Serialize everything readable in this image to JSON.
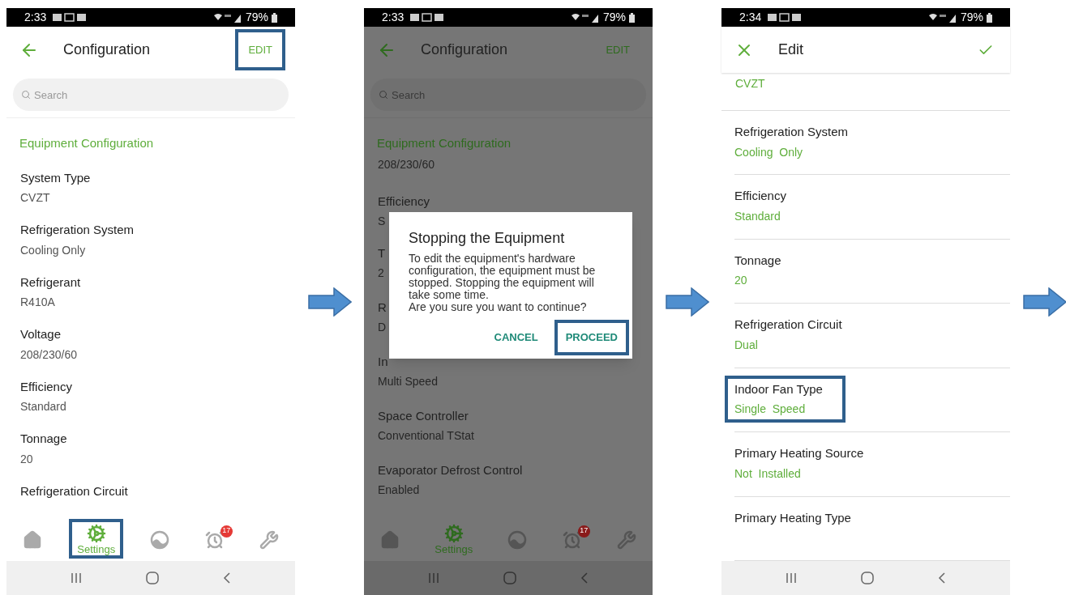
{
  "screens": [
    {
      "dimmed": false,
      "status": {
        "time": "2:33",
        "battery": "79%"
      },
      "header": {
        "kind": "back",
        "title": "Configuration",
        "action": {
          "kind": "text",
          "label": "EDIT",
          "highlighted": true
        }
      },
      "search": {
        "placeholder": "Search"
      },
      "section": "Equipment Configuration",
      "rows": [
        {
          "label": "System Type",
          "value": "CVZT",
          "highlighted": false
        },
        {
          "label": "Refrigeration System",
          "value": "Cooling Only",
          "highlighted": false
        },
        {
          "label": "Refrigerant",
          "value": "R410A",
          "highlighted": false
        },
        {
          "label": "Voltage",
          "value": "208/230/60",
          "highlighted": false
        },
        {
          "label": "Efficiency",
          "value": "Standard",
          "highlighted": false
        },
        {
          "label": "Tonnage",
          "value": "20",
          "highlighted": false
        },
        {
          "label": "Refrigeration Circuit",
          "highlighted": false
        }
      ],
      "tabs": [
        {
          "selected": false,
          "highlighted": false
        },
        {
          "label": "Settings",
          "selected": true,
          "highlighted": true
        },
        {
          "selected": false,
          "highlighted": false
        },
        {
          "badge": "17",
          "selected": false,
          "highlighted": false
        },
        {
          "selected": false,
          "highlighted": false
        }
      ]
    },
    {
      "dimmed": true,
      "status": {
        "time": "2:33",
        "battery": "79%"
      },
      "header": {
        "kind": "back",
        "title": "Configuration",
        "action": {
          "kind": "text",
          "label": "EDIT",
          "highlighted": false
        }
      },
      "search": {
        "placeholder": "Search"
      },
      "section": "Equipment Configuration",
      "lead_value": "208/230/60",
      "rows": [
        {
          "label": "Efficiency",
          "value": "S",
          "highlighted": false
        },
        {
          "label": "T",
          "value": "2",
          "highlighted": false
        },
        {
          "label": "R",
          "value": "D",
          "highlighted": false
        },
        {
          "label": "In",
          "value": "Multi Speed",
          "highlighted": false
        },
        {
          "label": "Space Controller",
          "value": "Conventional TStat",
          "highlighted": false
        },
        {
          "label": "Evaporator Defrost Control",
          "value": "Enabled",
          "highlighted": false
        }
      ],
      "dialog": {
        "title": "Stopping the Equipment",
        "message": "To edit the equipment's hardware configuration, the equipment must be stopped. Stopping the equipment will take some time.\nAre you sure you want to continue?",
        "buttons": [
          {
            "label": "CANCEL",
            "highlighted": false
          },
          {
            "label": "PROCEED",
            "highlighted": true
          }
        ]
      },
      "tabs": [
        {
          "selected": false,
          "highlighted": false
        },
        {
          "label": "Settings",
          "selected": true,
          "highlighted": false
        },
        {
          "selected": false,
          "highlighted": false
        },
        {
          "badge": "17",
          "selected": false,
          "highlighted": false
        },
        {
          "selected": false,
          "highlighted": false
        }
      ]
    },
    {
      "dimmed": false,
      "status": {
        "time": "2:34",
        "battery": "79%"
      },
      "header": {
        "kind": "close",
        "title": "Edit",
        "action": {
          "kind": "check",
          "highlighted": false
        }
      },
      "lead_value": "CVZT",
      "rows": [
        {
          "label": "Refrigeration System",
          "value": "Cooling  Only",
          "highlighted": false
        },
        {
          "label": "Efficiency",
          "value": "Standard",
          "highlighted": false
        },
        {
          "label": "Tonnage",
          "value": "20",
          "highlighted": false
        },
        {
          "label": "Refrigeration Circuit",
          "value": "Dual",
          "highlighted": false
        },
        {
          "label": "Indoor Fan Type",
          "value": "Single  Speed",
          "highlighted": true
        },
        {
          "label": "Primary Heating Source",
          "value": "Not  Installed",
          "highlighted": false
        },
        {
          "label": "Primary Heating Type",
          "highlighted": false
        }
      ]
    }
  ]
}
